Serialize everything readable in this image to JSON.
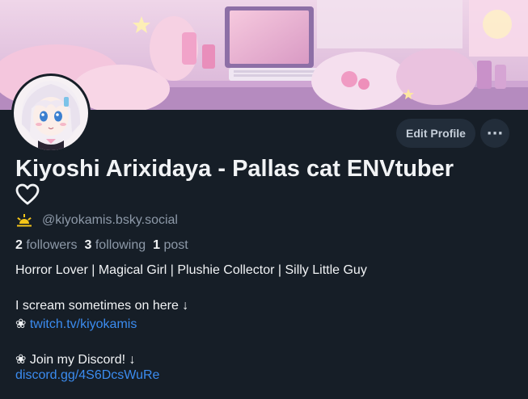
{
  "profile": {
    "display_name": "Kiyoshi Arixidaya - Pallas cat ENVtuber",
    "name_suffix_icon": "heart-outline-icon",
    "handle_icon": "sunrise-icon",
    "handle": "@kiyokamis.bsky.social",
    "stats": {
      "followers_count": "2",
      "followers_label": "followers",
      "following_count": "3",
      "following_label": "following",
      "posts_count": "1",
      "posts_label": "post"
    }
  },
  "actions": {
    "edit_profile_label": "Edit Profile",
    "more_label": "···"
  },
  "bio": {
    "line1": "Horror Lover | Magical Girl | Plushie Collector | Silly Little Guy",
    "line2": "I scream sometimes on here ↓",
    "flower": "❀",
    "twitch_link": "twitch.tv/kiyokamis",
    "line4": "❀ Join my Discord! ↓",
    "discord_link": "discord.gg/4S6DcsWuRe"
  },
  "colors": {
    "background": "#161e27",
    "text": "#f1f3f5",
    "muted": "#8d99a8",
    "link": "#3b8cf0",
    "button": "#222d3a",
    "sun": "#f5c518"
  }
}
